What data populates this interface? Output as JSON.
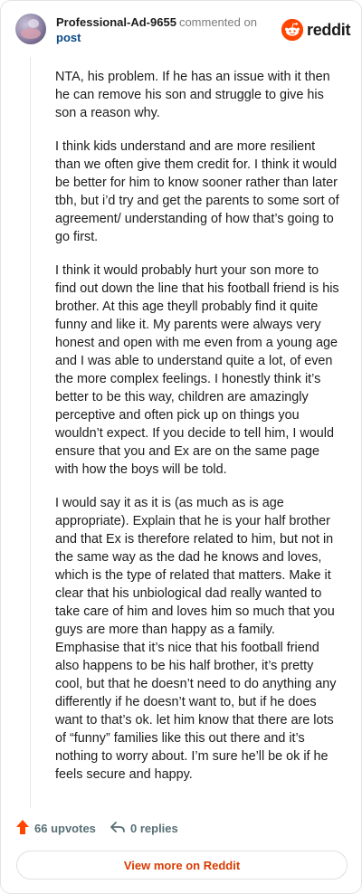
{
  "header": {
    "username": "Professional-Ad-9655",
    "action_text": "commented on",
    "post_link": "post",
    "brand_name": "reddit"
  },
  "comment": {
    "paragraphs": [
      "NTA, his problem. If he has an issue with it then he can remove his son and struggle to give his son a reason why.",
      "I think kids understand and are more resilient than we often give them credit for. I think it would be better for him to know sooner rather than later tbh, but i’d try and get the parents to some sort of agreement/ understanding of how that’s going to go first.",
      "I think it would probably hurt your son more to find out down the line that his football friend is his brother. At this age theyll probably find it quite funny and like it. My parents were always very honest and open with me even from a young age and I was able to understand quite a lot, of even the more complex feelings. I honestly think it’s better to be this way, children are amazingly perceptive and often pick up on things you wouldn’t expect. If you decide to tell him, I would ensure that you and Ex are on the same page with how the boys will be told.",
      "I would say it as it is (as much as is age appropriate). Explain that he is your half brother and that Ex is therefore related to him, but not in the same way as the dad he knows and loves, which is the type of related that matters. Make it clear that his unbiological dad really wanted to take care of him and loves him so much that you guys are more than happy as a family. Emphasise that it’s nice that his football friend also happens to be his half brother, it’s pretty cool, but that he doesn’t need to do anything any differently if he doesn’t want to, but if he does want to that’s ok. let him know that there are lots of “funny” families like this out there and it’s nothing to worry about. I’m sure he’ll be ok if he feels secure and happy."
    ]
  },
  "footer": {
    "upvotes": "66 upvotes",
    "replies": "0 replies",
    "view_more": "View more on Reddit"
  },
  "colors": {
    "brand": "#ff4500",
    "link": "#0a4a8a",
    "cta_text": "#d93a00",
    "upvote_icon": "#ff4500",
    "muted": "#576f76"
  },
  "icons": {
    "upvote": "upvote-arrow-icon",
    "reply": "reply-arrow-icon",
    "brand": "reddit-snoo-icon"
  }
}
